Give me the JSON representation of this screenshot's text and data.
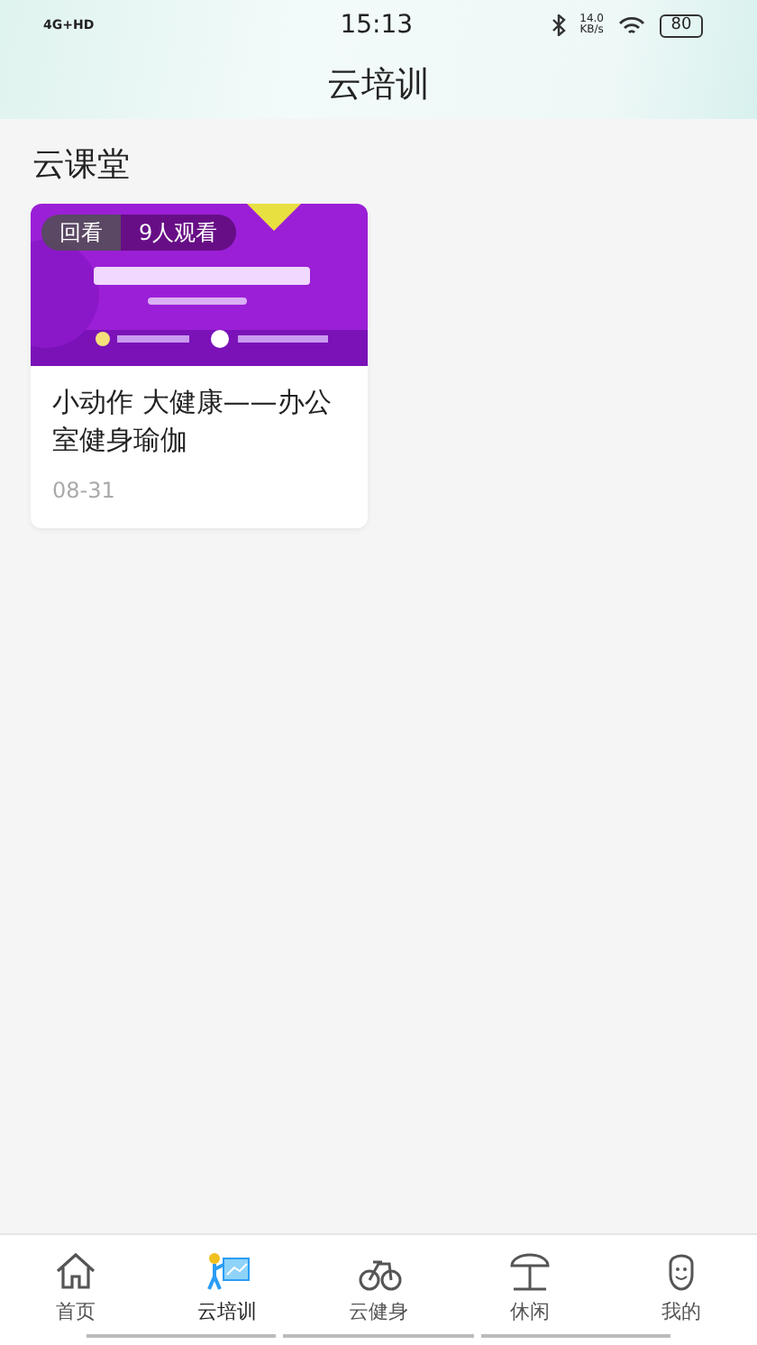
{
  "status_bar": {
    "network": "4G+HD",
    "time": "15:13",
    "speed": "14.0",
    "speed_unit": "KB/s",
    "battery": "80"
  },
  "header": {
    "title": "云培训"
  },
  "section": {
    "title": "云课堂"
  },
  "courses": [
    {
      "kind": "picture",
      "badge": "回看",
      "viewers": "9人观看",
      "title": "小动作 大健康——办公室健身瑜伽",
      "date": "08-31"
    }
  ],
  "tabs": [
    {
      "label": "首页",
      "kind": "home",
      "selected": false
    },
    {
      "label": "云培训",
      "kind": "training",
      "selected": true
    },
    {
      "label": "云健身",
      "kind": "fitness",
      "selected": false
    },
    {
      "label": "休闲",
      "kind": "leisure",
      "selected": false
    },
    {
      "label": "我的",
      "kind": "profile",
      "selected": false
    }
  ]
}
